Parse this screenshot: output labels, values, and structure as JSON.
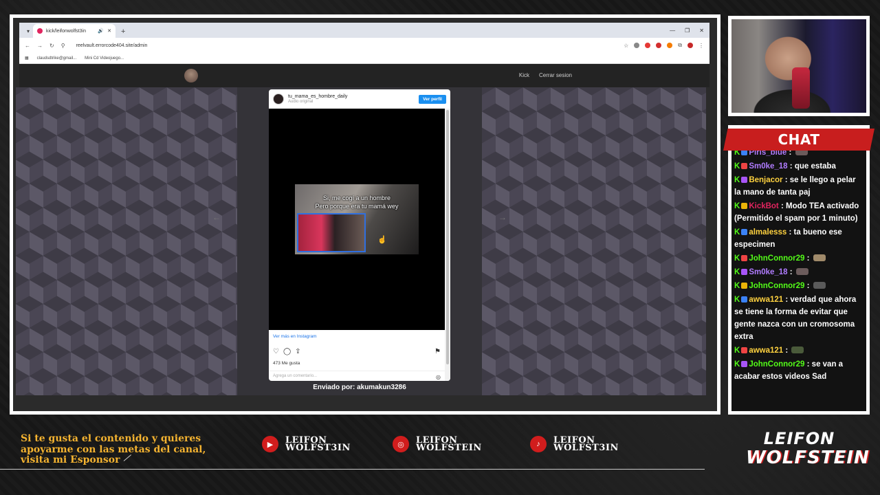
{
  "browser": {
    "tab_title": "kick/leifonwolfst3in",
    "url": "reelvault.errorcode404.site/admin",
    "bookmarks": [
      "claudsdtrike@gmail...",
      "Mini Cd Videojuego..."
    ]
  },
  "site": {
    "nav": [
      "Kick",
      "Cerrar sesion"
    ]
  },
  "instagram": {
    "username": "tu_mama_es_hombre_daily",
    "audio": "Audio original",
    "view_profile": "Ver perfil",
    "caption_line1": "Si, me cogí a un hombre",
    "caption_line2": "Pero porque era tu mamá wey",
    "more_link": "Ver más en Instagram",
    "likes": "473 Me gusta",
    "comment_placeholder": "Agrega un comentario..."
  },
  "sent_by": "Enviado por: akumakun3286",
  "chat": {
    "title": "CHAT",
    "messages": [
      {
        "user": "Piris_blue",
        "user_color": "#b07cff",
        "text": " : "
      },
      {
        "user": "Sm0ke_18",
        "user_color": "#b07cff",
        "text": " : que estaba"
      },
      {
        "user": "Benjacor",
        "user_color": "#ffd23f",
        "text": " : se le llego a pelar la mano de tanta paj"
      },
      {
        "user": "KickBot",
        "user_color": "#e0245e",
        "text": " : Modo TEA activado (Permitido el spam por 1 minuto)"
      },
      {
        "user": "almalesss",
        "user_color": "#ffd23f",
        "text": " : ta bueno ese especimen"
      },
      {
        "user": "JohnConnor29",
        "user_color": "#53fc18",
        "text": " : "
      },
      {
        "user": "Sm0ke_18",
        "user_color": "#b07cff",
        "text": " : "
      },
      {
        "user": "JohnConnor29",
        "user_color": "#53fc18",
        "text": " : "
      },
      {
        "user": "awwa121",
        "user_color": "#ffd23f",
        "text": " : verdad que ahora se tiene la forma de evitar que gente nazca con un cromosoma extra"
      },
      {
        "user": "awwa121",
        "user_color": "#ffd23f",
        "text": " : "
      },
      {
        "user": "JohnConnor29",
        "user_color": "#53fc18",
        "text": " : se van a acabar estos videos Sad"
      }
    ]
  },
  "bottom": {
    "support_text": "Si te gusta el contenido y quieres apoyarme con las metas del canal, visita mi Esponsor",
    "socials": [
      {
        "icon": "youtube-icon",
        "line1": "LEIFON",
        "line2": "WOLFST3IN"
      },
      {
        "icon": "instagram-icon",
        "line1": "LEIFON",
        "line2": "WOLFSTEIN"
      },
      {
        "icon": "tiktok-icon",
        "line1": "LEIFON",
        "line2": "WOLFST3IN"
      }
    ],
    "brand_line1": "LEIFON",
    "brand_line2": "WOLFSTEIN"
  },
  "colors": {
    "accent_red": "#c81e1e",
    "kick_green": "#53fc18",
    "gold_text": "#f4b330"
  }
}
